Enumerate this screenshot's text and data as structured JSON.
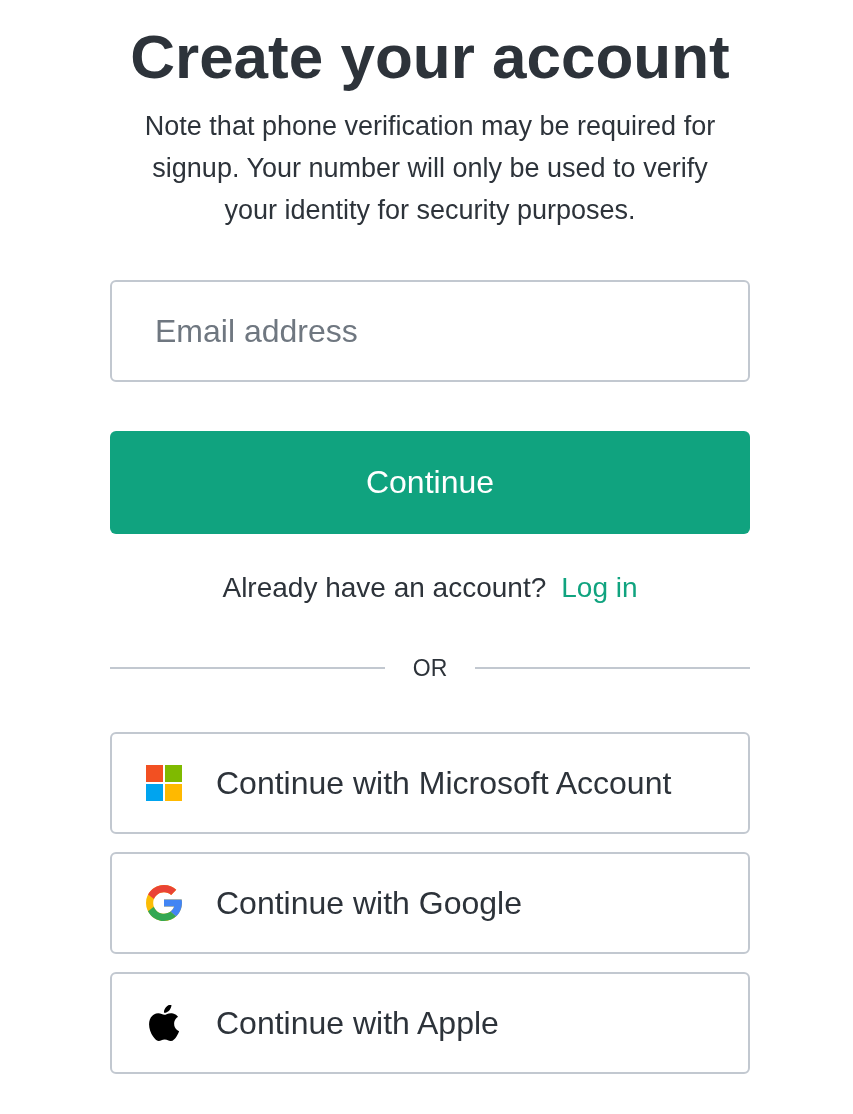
{
  "title": "Create your account",
  "note": "Note that phone verification may be required for signup. Your number will only be used to verify your identity for security purposes.",
  "email_field": {
    "placeholder": "Email address"
  },
  "continue_button": {
    "label": "Continue"
  },
  "login_prompt": {
    "text": "Already have an account?",
    "link": "Log in"
  },
  "divider": {
    "label": "OR"
  },
  "social_buttons": [
    {
      "kind": "microsoft",
      "label": "Continue with Microsoft Account"
    },
    {
      "kind": "google",
      "label": "Continue with Google"
    },
    {
      "kind": "apple",
      "label": "Continue with Apple"
    }
  ]
}
